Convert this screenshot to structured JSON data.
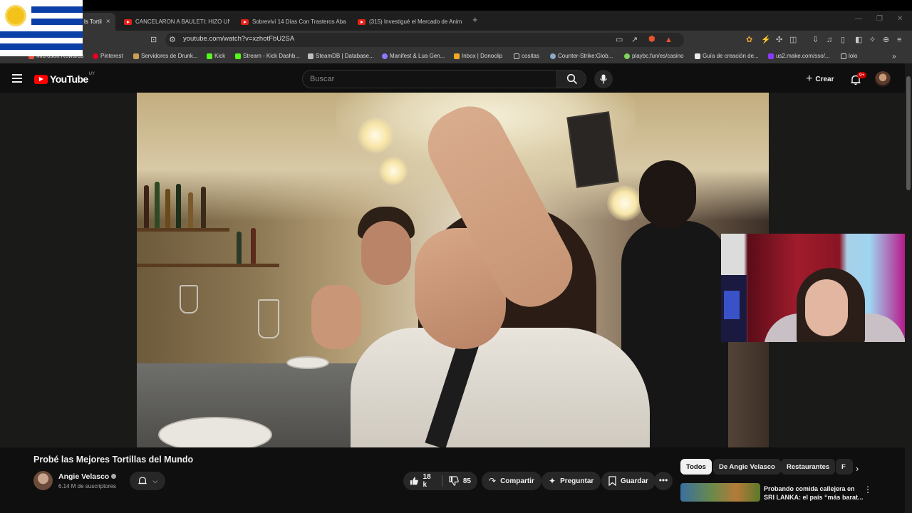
{
  "browser": {
    "tabs": [
      {
        "label": "ls Tortil",
        "active": true
      },
      {
        "label": "CANCELARON A BAULETI: HIZO UN"
      },
      {
        "label": "Sobreviví 14 Días Con Trasteros Aban"
      },
      {
        "label": "(315) Investigué el Mercado de Anim"
      }
    ],
    "tab_close": "×",
    "new_tab": "+",
    "url": "youtube.com/watch?v=xzhotFbU2SA",
    "bookmarks": [
      {
        "label": "Microsoft Rewards",
        "color": "#e84c3d"
      },
      {
        "label": "Pinterest",
        "color": "#e60023"
      },
      {
        "label": "Servidores de Drunk...",
        "color": "#caa052"
      },
      {
        "label": "Kick",
        "color": "#53fc18"
      },
      {
        "label": "Stream - Kick Dashb...",
        "color": "#53fc18"
      },
      {
        "label": "SteamDB | Database...",
        "color": "#bfbfbf"
      },
      {
        "label": "Manifest & Lua Gen...",
        "color": "#8a7aff"
      },
      {
        "label": "Inbox | Donoclip",
        "color": "#f5a623"
      },
      {
        "label": "cositas",
        "color": "#cfcfcf"
      },
      {
        "label": "Counter-Strike:Glob...",
        "color": "#8aa8c8"
      },
      {
        "label": "playbc.fun/es/casino",
        "color": "#7fd35a"
      },
      {
        "label": "Guía de creación de...",
        "color": "#eaeaea"
      },
      {
        "label": "us2.make.com/sso/...",
        "color": "#8a3aff"
      },
      {
        "label": "lolo",
        "color": "#cfcfcf"
      }
    ],
    "bookmarks_overflow": "»",
    "window_controls": [
      "—",
      "❐",
      "✕"
    ]
  },
  "youtube": {
    "logo": "YouTube",
    "country": "UY",
    "search_placeholder": "Buscar",
    "create_label": "Crear",
    "notification_badge": "9+",
    "video": {
      "title": "Probé las Mejores Tortillas del Mundo"
    },
    "channel": {
      "name": "Angie Velasco",
      "subscribers": "6.14 M de suscriptores"
    },
    "actions": {
      "likes": "18 k",
      "dislikes": "85",
      "share": "Compartir",
      "ask": "Preguntar",
      "save": "Guardar",
      "more": "•••"
    },
    "chips": [
      {
        "label": "Todos",
        "active": true
      },
      {
        "label": "De Angie Velasco"
      },
      {
        "label": "Restaurantes"
      },
      {
        "label": "F"
      }
    ],
    "recommendation": {
      "title": "Probando comida callejera en SRI LANKA: el país “más barat..."
    }
  },
  "colors": {
    "youtube_red": "#ff0000",
    "page_bg": "#0f0f0f",
    "browser_chrome": "#353535"
  }
}
